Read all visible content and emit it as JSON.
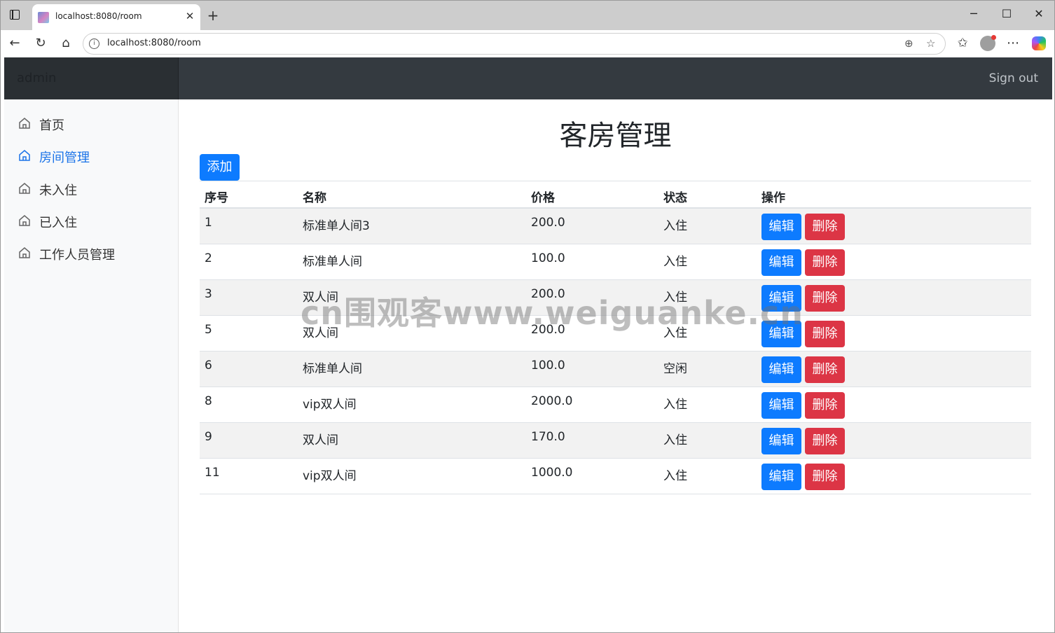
{
  "browser": {
    "tab_title": "localhost:8080/room",
    "url": "localhost:8080/room",
    "new_tab": "+",
    "window_controls": {
      "minimize": "─",
      "maximize": "☐",
      "close": "✕"
    }
  },
  "navbar": {
    "brand": "admin",
    "signout": "Sign out"
  },
  "sidebar": {
    "items": [
      {
        "label": "首页",
        "icon": "home-icon"
      },
      {
        "label": "房间管理",
        "icon": "home-icon",
        "active": true
      },
      {
        "label": "未入住",
        "icon": "home-icon"
      },
      {
        "label": "已入住",
        "icon": "home-icon"
      },
      {
        "label": "工作人员管理",
        "icon": "home-icon"
      }
    ]
  },
  "main": {
    "title": "客房管理",
    "add_label": "添加",
    "columns": [
      "序号",
      "名称",
      "价格",
      "状态",
      "操作"
    ],
    "edit_label": "编辑",
    "delete_label": "删除",
    "rows": [
      {
        "id": "1",
        "name": "标准单人间3",
        "price": "200.0",
        "status": "入住"
      },
      {
        "id": "2",
        "name": "标准单人间",
        "price": "100.0",
        "status": "入住"
      },
      {
        "id": "3",
        "name": "双人间",
        "price": "200.0",
        "status": "入住"
      },
      {
        "id": "5",
        "name": "双人间",
        "price": "200.0",
        "status": "入住"
      },
      {
        "id": "6",
        "name": "标准单人间",
        "price": "100.0",
        "status": "空闲"
      },
      {
        "id": "8",
        "name": "vip双人间",
        "price": "2000.0",
        "status": "入住"
      },
      {
        "id": "9",
        "name": "双人间",
        "price": "170.0",
        "status": "入住"
      },
      {
        "id": "11",
        "name": "vip双人间",
        "price": "1000.0",
        "status": "入住"
      }
    ]
  },
  "watermark": "cn围观客www.weiguanke.cn",
  "colors": {
    "primary": "#0d7bff",
    "danger": "#dc3545",
    "navbar": "#343a40",
    "active_link": "#1a73e8"
  }
}
